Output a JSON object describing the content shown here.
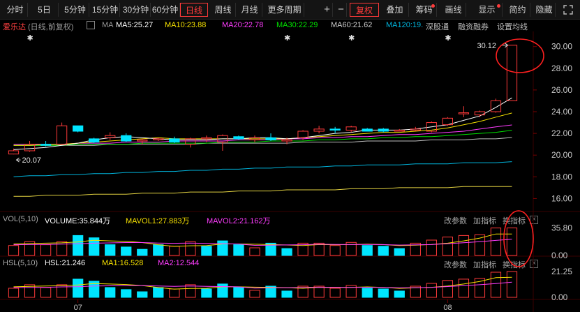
{
  "toolbar": {
    "periods": [
      "分时",
      "5日",
      "5分钟",
      "15分钟",
      "30分钟",
      "60分钟",
      "日线",
      "周线",
      "月线",
      "更多周期"
    ],
    "active_period": "日线",
    "plus": "+",
    "minus": "−",
    "adjust": "复权",
    "overlay": "叠加",
    "chips": "筹码",
    "draw": "画线",
    "display": "显示",
    "simple": "简约",
    "hide": "隐藏"
  },
  "main_header": {
    "stock_name": "爱乐达",
    "mode": "(日线,前复权)",
    "ma_label": "MA",
    "ma5": "MA5:25.27",
    "ma10": "MA10:23.88",
    "ma20": "MA20:22.78",
    "ma30": "MA30:22.29",
    "ma60": "MA60:21.62",
    "ma120": "MA120:19.",
    "shen_gu_tong": "深股通",
    "margin": "融资融券",
    "ma_settings": "设置均线"
  },
  "vol_header": {
    "name": "VOL(5,10)",
    "volume": "VOLUME:35.844万",
    "mavol1": "MAVOL1:27.883万",
    "mavol2": "MAVOL2:21.162万",
    "change_params": "改参数",
    "add_indicator": "加指标",
    "switch_indicator": "换指标"
  },
  "hsl_header": {
    "name": "HSL(5,10)",
    "hsl": "HSL:21.246",
    "ma1": "MA1:16.528",
    "ma2": "MA2:12.544",
    "change_params": "改参数",
    "add_indicator": "加指标",
    "switch_indicator": "换指标"
  },
  "price_axis": [
    "30.00",
    "28.00",
    "26.00",
    "24.00",
    "22.00",
    "20.00",
    "18.00",
    "16.00"
  ],
  "vol_axis": [
    "35.80",
    "0.00"
  ],
  "hsl_axis": [
    "21.25",
    "0.00"
  ],
  "date_labels": [
    "07",
    "08"
  ],
  "annotations": {
    "high_price": "30.12",
    "low_price": "20.07"
  },
  "colors": {
    "up": "#ff3a3a",
    "down": "#00e5ff",
    "ma5": "#ffffff",
    "ma10": "#f5e000",
    "ma20": "#ff3cff",
    "ma30": "#00e000",
    "ma60": "#bebebe",
    "ma120": "#00b4dc",
    "ma250": "#e0d040",
    "annotation_circle": "#ff2020"
  },
  "chart_data": {
    "type": "candlestick",
    "ohlc": [
      [
        20.1,
        20.6,
        20.07,
        20.4
      ],
      [
        20.4,
        21.3,
        20.3,
        21.0
      ],
      [
        21.0,
        21.3,
        20.8,
        20.9
      ],
      [
        21.0,
        23.0,
        21.0,
        22.7
      ],
      [
        22.7,
        22.7,
        22.1,
        22.2
      ],
      [
        21.5,
        21.6,
        21.1,
        21.2
      ],
      [
        21.6,
        22.1,
        21.4,
        21.8
      ],
      [
        21.8,
        22.0,
        21.2,
        21.3
      ],
      [
        21.3,
        21.5,
        21.0,
        21.4
      ],
      [
        21.4,
        21.6,
        21.3,
        21.5
      ],
      [
        21.5,
        21.7,
        21.1,
        21.2
      ],
      [
        21.0,
        21.6,
        20.7,
        21.5
      ],
      [
        21.5,
        21.8,
        21.2,
        21.6
      ],
      [
        21.2,
        21.9,
        20.4,
        21.8
      ],
      [
        21.7,
        21.8,
        21.4,
        21.5
      ],
      [
        21.4,
        21.8,
        21.2,
        21.6
      ],
      [
        21.6,
        22.0,
        21.3,
        21.4
      ],
      [
        21.3,
        21.6,
        21.0,
        21.4
      ],
      [
        21.6,
        22.3,
        21.4,
        22.2
      ],
      [
        22.2,
        22.7,
        22.0,
        22.4
      ],
      [
        22.4,
        22.6,
        22.0,
        22.3
      ],
      [
        22.3,
        22.7,
        22.1,
        22.6
      ],
      [
        22.4,
        22.5,
        22.2,
        22.2
      ],
      [
        22.4,
        22.5,
        22.1,
        22.2
      ],
      [
        22.2,
        22.4,
        22.2,
        22.3
      ],
      [
        22.3,
        22.6,
        22.2,
        22.4
      ],
      [
        22.2,
        23.1,
        22.1,
        23.0
      ],
      [
        22.8,
        23.5,
        22.7,
        23.4
      ],
      [
        23.8,
        24.5,
        23.5,
        23.9
      ],
      [
        23.7,
        24.1,
        23.5,
        24.0
      ],
      [
        24.0,
        25.2,
        23.9,
        25.0
      ],
      [
        25.0,
        30.12,
        25.0,
        30.12
      ]
    ],
    "volume": [
      13.0,
      18.0,
      14.0,
      18.0,
      26.0,
      23.0,
      14.0,
      11.0,
      8.0,
      14.0,
      12.0,
      18.0,
      12.0,
      19.0,
      14.0,
      10.0,
      16.0,
      9.0,
      16.0,
      16.0,
      13.0,
      17.0,
      13.0,
      12.0,
      9.0,
      16.0,
      20.0,
      24.0,
      26.0,
      27.0,
      35.8,
      35.844
    ],
    "volume_up": [
      true,
      true,
      true,
      true,
      false,
      false,
      false,
      false,
      false,
      false,
      true,
      true,
      false,
      false,
      false,
      true,
      false,
      false,
      true,
      true,
      true,
      true,
      false,
      false,
      false,
      true,
      true,
      true,
      true,
      true,
      true,
      true
    ],
    "mavol1": [
      15.0,
      15.5,
      16.0,
      16.5,
      17.6,
      19.8,
      19.0,
      18.4,
      16.8,
      14.0,
      11.8,
      12.6,
      12.8,
      15.0,
      15.0,
      14.6,
      14.2,
      13.6,
      13.0,
      14.2,
      14.0,
      14.2,
      14.8,
      14.2,
      12.8,
      13.4,
      14.4,
      16.0,
      19.0,
      22.6,
      28.0,
      27.883
    ],
    "mavol2": [
      14.0,
      14.2,
      14.4,
      14.8,
      15.2,
      16.0,
      16.4,
      16.8,
      16.8,
      16.2,
      15.8,
      16.1,
      15.6,
      15.4,
      14.9,
      13.2,
      13.4,
      13.7,
      14.0,
      14.6,
      14.3,
      14.2,
      14.3,
      14.1,
      13.5,
      13.8,
      14.2,
      15.4,
      16.6,
      18.0,
      19.6,
      21.162
    ],
    "hsl": [
      7.5,
      10.4,
      8.1,
      10.4,
      15.0,
      13.3,
      8.1,
      6.4,
      4.6,
      8.1,
      6.9,
      10.4,
      6.9,
      11.0,
      8.1,
      5.8,
      9.2,
      5.2,
      9.2,
      9.2,
      7.5,
      9.8,
      7.5,
      6.9,
      5.2,
      9.2,
      11.5,
      13.9,
      15.0,
      15.6,
      20.7,
      21.246
    ],
    "hsl_ma1": [
      8.7,
      9.0,
      9.3,
      9.6,
      10.2,
      11.4,
      11.0,
      10.6,
      9.7,
      8.1,
      6.8,
      7.3,
      7.4,
      8.7,
      8.7,
      8.4,
      8.2,
      7.9,
      7.5,
      8.2,
      8.1,
      8.2,
      8.6,
      8.2,
      7.4,
      7.8,
      8.3,
      9.3,
      11.0,
      13.1,
      16.2,
      16.528
    ],
    "hsl_ma2": [
      8.1,
      8.2,
      8.3,
      8.6,
      8.8,
      9.3,
      9.5,
      9.7,
      9.7,
      9.4,
      9.1,
      9.3,
      9.0,
      8.9,
      8.6,
      7.6,
      7.8,
      7.9,
      8.1,
      8.4,
      8.3,
      8.2,
      8.3,
      8.2,
      7.8,
      8.0,
      8.2,
      8.9,
      9.6,
      10.4,
      11.3,
      12.544
    ],
    "ma5": [
      20.5,
      20.6,
      20.7,
      20.9,
      21.1,
      21.4,
      21.6,
      21.7,
      21.6,
      21.5,
      21.4,
      21.4,
      21.4,
      21.5,
      21.5,
      21.6,
      21.6,
      21.5,
      21.6,
      21.8,
      22.0,
      22.1,
      22.3,
      22.3,
      22.3,
      22.4,
      22.6,
      22.8,
      23.2,
      23.6,
      24.4,
      25.27
    ],
    "ma10": [
      20.9,
      20.9,
      21.0,
      21.0,
      21.1,
      21.2,
      21.3,
      21.4,
      21.5,
      21.6,
      21.5,
      21.5,
      21.5,
      21.5,
      21.5,
      21.5,
      21.5,
      21.5,
      21.6,
      21.7,
      21.8,
      21.9,
      22.0,
      22.1,
      22.1,
      22.2,
      22.3,
      22.5,
      22.8,
      23.1,
      23.5,
      23.88
    ],
    "ma20": [
      21.0,
      21.0,
      21.0,
      21.0,
      21.1,
      21.1,
      21.1,
      21.2,
      21.2,
      21.2,
      21.3,
      21.3,
      21.3,
      21.3,
      21.4,
      21.4,
      21.4,
      21.5,
      21.5,
      21.6,
      21.6,
      21.7,
      21.7,
      21.8,
      21.9,
      21.9,
      22.0,
      22.1,
      22.2,
      22.4,
      22.6,
      22.78
    ],
    "ma30": [
      20.9,
      20.9,
      20.9,
      20.9,
      21.0,
      21.0,
      21.0,
      21.0,
      21.1,
      21.1,
      21.1,
      21.1,
      21.1,
      21.2,
      21.2,
      21.2,
      21.3,
      21.3,
      21.3,
      21.4,
      21.4,
      21.5,
      21.5,
      21.6,
      21.6,
      21.7,
      21.7,
      21.8,
      21.9,
      22.0,
      22.1,
      22.29
    ],
    "ma60": [
      20.9,
      20.9,
      20.9,
      20.9,
      20.9,
      20.9,
      21.0,
      21.0,
      21.0,
      21.0,
      21.0,
      21.0,
      21.1,
      21.1,
      21.1,
      21.1,
      21.1,
      21.1,
      21.2,
      21.2,
      21.2,
      21.2,
      21.3,
      21.3,
      21.3,
      21.3,
      21.4,
      21.4,
      21.4,
      21.5,
      21.5,
      21.62
    ],
    "ma120": [
      18.0,
      18.1,
      18.1,
      18.2,
      18.2,
      18.3,
      18.3,
      18.4,
      18.4,
      18.5,
      18.5,
      18.6,
      18.6,
      18.7,
      18.7,
      18.8,
      18.8,
      18.9,
      18.9,
      18.9,
      19.0,
      19.0,
      19.1,
      19.1,
      19.1,
      19.2,
      19.2,
      19.2,
      19.3,
      19.3,
      19.3,
      19.4
    ],
    "ma250": [
      16.2,
      16.2,
      16.3,
      16.3,
      16.3,
      16.4,
      16.4,
      16.4,
      16.5,
      16.5,
      16.5,
      16.6,
      16.6,
      16.6,
      16.7,
      16.7,
      16.7,
      16.8,
      16.8,
      16.8,
      16.8,
      16.9,
      16.9,
      16.9,
      17.0,
      17.0,
      17.0,
      17.0,
      17.1,
      17.1,
      17.1,
      17.1
    ],
    "price_ylim": [
      15.0,
      31.2
    ],
    "vol_ylim": [
      0,
      40
    ],
    "hsl_ylim": [
      0,
      23
    ]
  }
}
